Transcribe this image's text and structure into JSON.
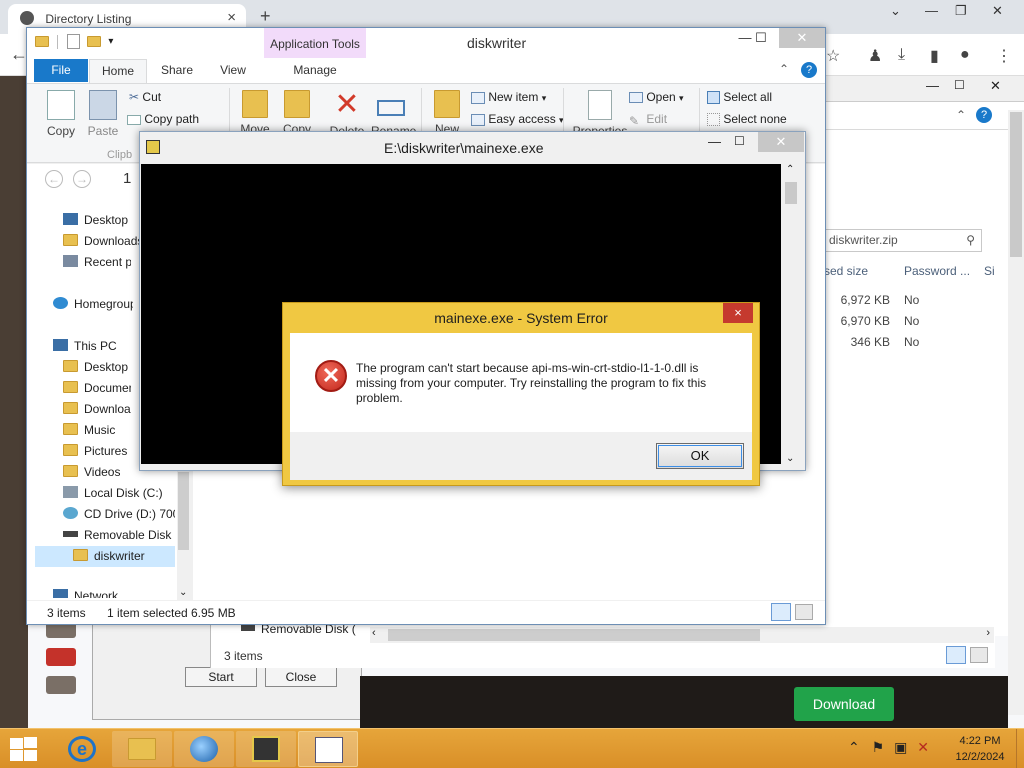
{
  "browser": {
    "tab_title": "Directory Listing",
    "tab_close": "×",
    "new_tab": "+",
    "minimize": "⌄",
    "back": "←",
    "download_button": "Download"
  },
  "background_explorer": {
    "search_value": "diskwriter.zip",
    "columns": [
      "sed size",
      "Password ...",
      "Si"
    ],
    "rows": [
      {
        "size": "6,972 KB",
        "password": "No"
      },
      {
        "size": "6,970 KB",
        "password": "No"
      },
      {
        "size": "346 KB",
        "password": "No"
      }
    ],
    "nav_item": "Removable Disk (",
    "status": "3 items",
    "buttons": {
      "start": "Start",
      "close": "Close"
    }
  },
  "explorer": {
    "title": "diskwriter",
    "contextual_tab": "Application Tools",
    "tabs": [
      "File",
      "Home",
      "Share",
      "View",
      "Manage"
    ],
    "ribbon": {
      "copy": "Copy",
      "paste": "Paste",
      "cut": "Cut",
      "copy_path": "Copy path",
      "move_to": "Move",
      "copy_to": "Copy",
      "delete": "Delete",
      "rename": "Rename",
      "new_folder": "New",
      "new_item": "New item",
      "easy_access": "Easy access",
      "properties": "Properties",
      "open": "Open",
      "edit": "Edit",
      "select_all": "Select all",
      "select_none": "Select none",
      "clipboard_group": "Clipb"
    },
    "address_prefix": "1",
    "nav_pane": [
      {
        "label": "Desktop",
        "icon": "desktop-icon"
      },
      {
        "label": "Downloads",
        "icon": "folder-icon"
      },
      {
        "label": "Recent places",
        "icon": "recent-places-icon"
      },
      {
        "label": "Homegroup",
        "icon": "homegroup-icon"
      },
      {
        "label": "This PC",
        "icon": "computer-icon"
      },
      {
        "label": "Desktop",
        "icon": "desktop-folder-icon"
      },
      {
        "label": "Documents",
        "icon": "folder-icon"
      },
      {
        "label": "Downloads",
        "icon": "folder-icon"
      },
      {
        "label": "Music",
        "icon": "folder-icon"
      },
      {
        "label": "Pictures",
        "icon": "folder-icon"
      },
      {
        "label": "Videos",
        "icon": "folder-icon"
      },
      {
        "label": "Local Disk (C:)",
        "icon": "drive-icon"
      },
      {
        "label": "CD Drive (D:) 700",
        "icon": "cd-drive-icon"
      },
      {
        "label": "Removable Disk (",
        "icon": "removable-disk-icon"
      },
      {
        "label": "diskwriter",
        "icon": "folder-icon"
      },
      {
        "label": "Network",
        "icon": "network-icon"
      }
    ],
    "status": {
      "items": "3 items",
      "selected": "1 item selected",
      "size": "6.95 MB"
    }
  },
  "console": {
    "title": "E:\\diskwriter\\mainexe.exe"
  },
  "dialog": {
    "title": "mainexe.exe - System Error",
    "message": "The program can't start because api-ms-win-crt-stdio-l1-1-0.dll is missing from your computer. Try reinstalling the program to fix this problem.",
    "ok": "OK",
    "close": "×"
  },
  "taskbar": {
    "time": "4:22 PM",
    "date": "12/2/2024",
    "apps": [
      "internet-explorer-icon",
      "file-explorer-icon",
      "globe-app-icon",
      "installer-app-icon",
      "window-app-icon"
    ]
  }
}
